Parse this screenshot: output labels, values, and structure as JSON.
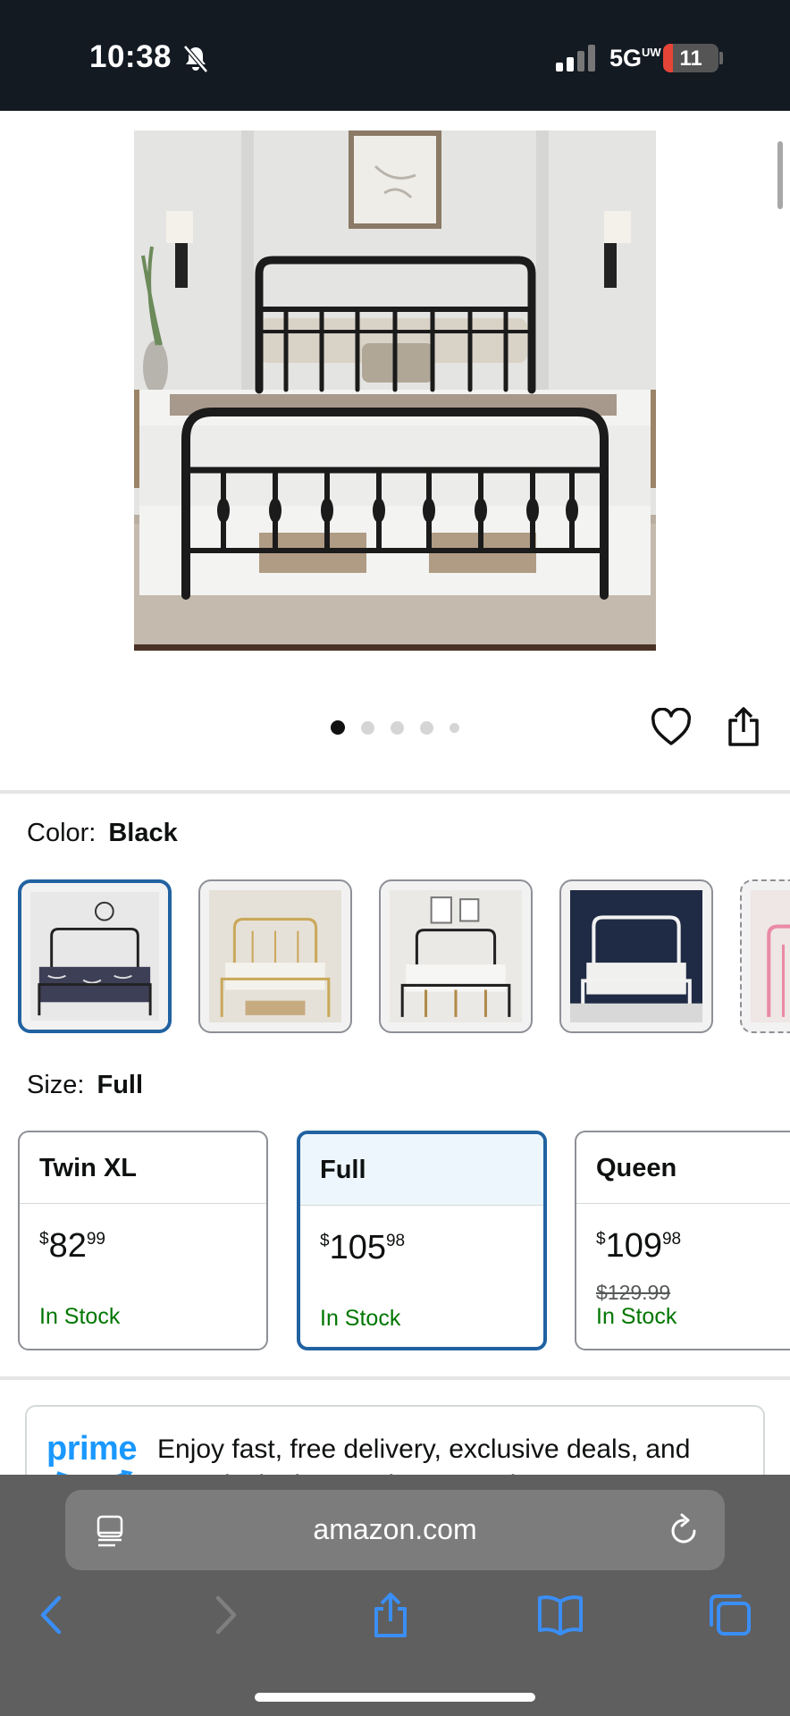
{
  "status_bar": {
    "time": "10:38",
    "network": "5G",
    "network_sub": "UW",
    "battery": "11"
  },
  "gallery": {
    "image_count": 5,
    "active_index": 0
  },
  "color": {
    "label": "Color:",
    "selected": "Black",
    "options": [
      "Black",
      "Gold",
      "Black with Gold",
      "White",
      "Pink"
    ]
  },
  "size": {
    "label": "Size:",
    "selected": "Full",
    "options": [
      {
        "name": "Twin XL",
        "price_symbol": "$",
        "price_whole": "82",
        "price_fraction": "99",
        "list_price": "",
        "stock": "In Stock"
      },
      {
        "name": "Full",
        "price_symbol": "$",
        "price_whole": "105",
        "price_fraction": "98",
        "list_price": "",
        "stock": "In Stock"
      },
      {
        "name": "Queen",
        "price_symbol": "$",
        "price_whole": "109",
        "price_fraction": "98",
        "list_price": "$129.99",
        "stock": "In Stock"
      }
    ]
  },
  "prime": {
    "logo": "prime",
    "text": "Enjoy fast, free delivery, exclusive deals, and award-winning movies & TV shows"
  },
  "browser": {
    "url": "amazon.com"
  },
  "colors": {
    "accent": "#2162a1",
    "stock_green": "#007600",
    "prime_blue": "#1a98ff",
    "status_bg": "#131a22",
    "toolbar_bg": "#5f5f5f",
    "icon_blue": "#3a8ef6"
  }
}
